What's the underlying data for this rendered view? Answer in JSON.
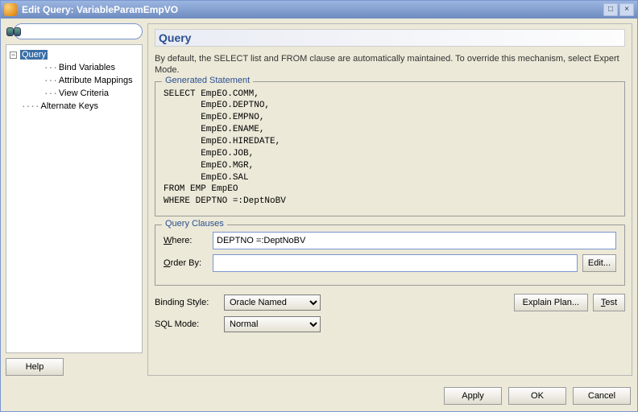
{
  "window": {
    "title": "Edit Query: VariableParamEmpVO"
  },
  "sidebar": {
    "search_value": "",
    "items": {
      "query": "Query",
      "bind_variables": "Bind Variables",
      "attribute_mappings": "Attribute Mappings",
      "view_criteria": "View Criteria",
      "alternate_keys": "Alternate Keys"
    }
  },
  "main": {
    "header": "Query",
    "description": "By default, the SELECT list and FROM clause are automatically maintained.  To override this mechanism, select Expert Mode.",
    "generated_legend": "Generated Statement",
    "generated_sql": "SELECT EmpEO.COMM,\n       EmpEO.DEPTNO,\n       EmpEO.EMPNO,\n       EmpEO.ENAME,\n       EmpEO.HIREDATE,\n       EmpEO.JOB,\n       EmpEO.MGR,\n       EmpEO.SAL\nFROM EMP EmpEO\nWHERE DEPTNO =:DeptNoBV",
    "clauses_legend": "Query Clauses",
    "where_label": "Where:",
    "where_value": "DEPTNO =:DeptNoBV",
    "orderby_label": "Order By:",
    "orderby_value": "",
    "edit_btn": "Edit...",
    "binding_style_label": "Binding Style:",
    "binding_style_value": "Oracle Named",
    "sql_mode_label": "SQL Mode:",
    "sql_mode_value": "Normal",
    "explain_btn": "Explain Plan...",
    "test_btn": "Test"
  },
  "actions": {
    "help": "Help",
    "apply": "Apply",
    "ok": "OK",
    "cancel": "Cancel"
  }
}
